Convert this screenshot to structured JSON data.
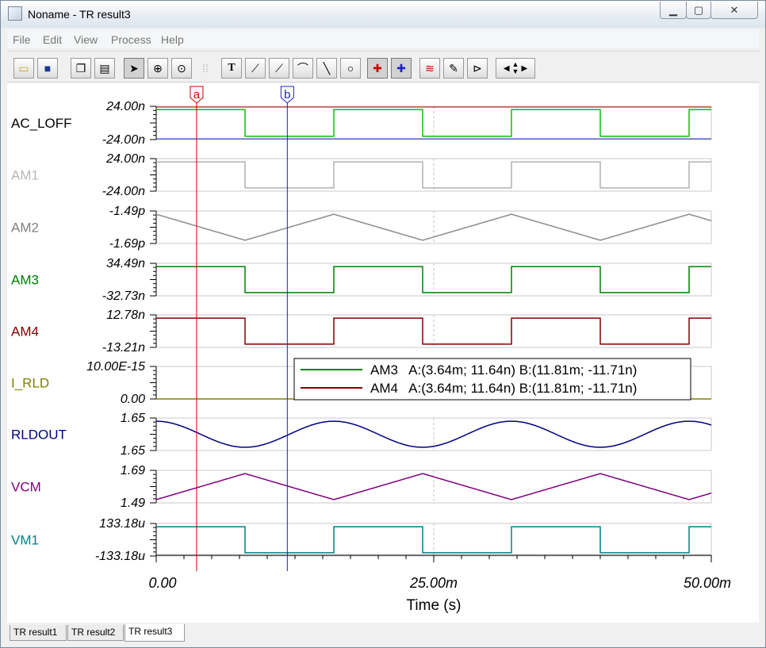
{
  "window": {
    "title": "Noname - TR result3",
    "controls": {
      "minimize": "▁",
      "maximize": "▢",
      "close": "✕"
    }
  },
  "menu": [
    "File",
    "Edit",
    "View",
    "Process",
    "Help"
  ],
  "toolbar": {
    "icons": [
      "open-icon",
      "save-icon",
      "copy-icon",
      "paste-icon",
      "pointer-icon",
      "zoom-in-icon",
      "zoom-100-icon",
      "grid-icon",
      "text-tool-icon",
      "curve-tool-1-icon",
      "curve-tool-2-icon",
      "curve-tool-3-icon",
      "line-tool-icon",
      "ellipse-tool-icon",
      "cursor-a-icon",
      "cursor-b-icon",
      "add-curve-icon",
      "probe-icon",
      "flag-icon",
      "arrow-left-icon",
      "arrow-up-icon",
      "arrow-down-icon",
      "arrow-right-icon"
    ]
  },
  "cursors": {
    "a": "a",
    "b": "b"
  },
  "plot": {
    "xlabel": "Time (s)",
    "x_ticks": [
      "0.00",
      "25.00m",
      "50.00m"
    ],
    "colors": {
      "a_cursor": "#cc0000",
      "b_cursor": "#2020c0"
    }
  },
  "traces": [
    {
      "name": "AC_LOFF",
      "top": "24.00n",
      "bottom": "-24.00n",
      "color": "#000000"
    },
    {
      "name": "AM1",
      "top": "24.00n",
      "bottom": "-24.00n",
      "color": "#b8b8b8"
    },
    {
      "name": "AM2",
      "top": "-1.49p",
      "bottom": "-1.69p",
      "color": "#808080"
    },
    {
      "name": "AM3",
      "top": "34.49n",
      "bottom": "-32.73n",
      "color": "#008000"
    },
    {
      "name": "AM4",
      "top": "12.78n",
      "bottom": "-13.21n",
      "color": "#800000"
    },
    {
      "name": "I_RLD",
      "top": "10.00E-15",
      "bottom": "0.00",
      "color": "#808000"
    },
    {
      "name": "RLDOUT",
      "top": "1.65",
      "bottom": "1.65",
      "color": "#000080"
    },
    {
      "name": "VCM",
      "top": "1.69",
      "bottom": "1.49",
      "color": "#800080"
    },
    {
      "name": "VM1",
      "top": "133.18u",
      "bottom": "-133.18u",
      "color": "#008080"
    }
  ],
  "legend": [
    {
      "series": "AM3",
      "text": "AM3   A:(3.64m; 11.64n) B:(11.81m; -11.71n)",
      "color": "#008000"
    },
    {
      "series": "AM4",
      "text": "AM4   A:(3.64m; 11.64n) B:(11.81m; -11.71n)",
      "color": "#800000"
    }
  ],
  "tabs": [
    "TR result1",
    "TR result2",
    "TR result3"
  ],
  "chart_data": {
    "type": "line",
    "xlabel": "Time (s)",
    "xlim": [
      0,
      0.05
    ],
    "x_ticks": [
      "0.00",
      "25.00m",
      "50.00m"
    ],
    "cursor_a_x": 0.00364,
    "cursor_b_x": 0.01181,
    "series": [
      {
        "name": "AC_LOFF",
        "top": "24.00n",
        "bottom": "-24.00n",
        "waveform": "square",
        "period": 0.016,
        "phase_high_first": true
      },
      {
        "name": "AM1",
        "top": "24.00n",
        "bottom": "-24.00n",
        "waveform": "square",
        "period": 0.016,
        "phase_high_first": true
      },
      {
        "name": "AM2",
        "top": "-1.49p",
        "bottom": "-1.69p",
        "waveform": "triangle",
        "period": 0.016,
        "starts": "high"
      },
      {
        "name": "AM3",
        "top": "34.49n",
        "bottom": "-32.73n",
        "waveform": "square",
        "period": 0.016,
        "phase_high_first": true
      },
      {
        "name": "AM4",
        "top": "12.78n",
        "bottom": "-13.21n",
        "waveform": "square",
        "period": 0.016,
        "phase_high_first": true
      },
      {
        "name": "I_RLD",
        "top": "10.00E-15",
        "bottom": "0.00",
        "waveform": "flat",
        "value": 0
      },
      {
        "name": "RLDOUT",
        "top": "1.65",
        "bottom": "1.65",
        "waveform": "smooth-triangle",
        "period": 0.016,
        "starts": "high"
      },
      {
        "name": "VCM",
        "top": "1.69",
        "bottom": "1.49",
        "waveform": "triangle",
        "period": 0.016,
        "starts": "low"
      },
      {
        "name": "VM1",
        "top": "133.18u",
        "bottom": "-133.18u",
        "waveform": "square",
        "period": 0.016,
        "phase_high_first": true
      }
    ]
  }
}
